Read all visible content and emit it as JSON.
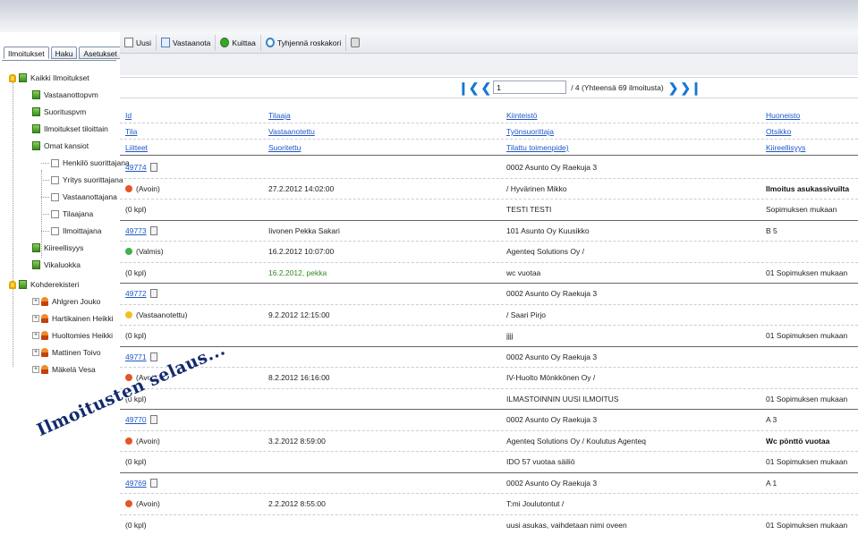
{
  "tabs": [
    "Ilmoitukset",
    "Haku",
    "Asetukset"
  ],
  "tree": {
    "root1": "Kaikki Ilmoitukset",
    "root1_children": [
      "Vastaanottopvm",
      "Suorituspvm",
      "Ilmoitukset tiloittain",
      "Omat kansiot"
    ],
    "omat_kansiot_children": [
      "Henkilö suorittajana",
      "Yritys suorittajana",
      "Vastaanottajana",
      "Tilaajana",
      "Ilmoittajana"
    ],
    "root1_more": [
      "Kiireellisyys",
      "Vikaluokka"
    ],
    "root2": "Kohderekisteri",
    "root2_children": [
      "Ahlgren Jouko",
      "Hartikainen Heikki",
      "Huoltomies Heikki",
      "Mattinen Toivo",
      "Mäkelä Vesa"
    ]
  },
  "toolbar": {
    "new": "Uusi",
    "receive": "Vastaanota",
    "acknowledge": "Kuittaa",
    "empty_trash": "Tyhjennä roskakori"
  },
  "pager": {
    "page": "1",
    "total": "/ 4 (Yhteensä 69 ilmoitusta)"
  },
  "headers": {
    "c1": [
      "Id",
      "Tila",
      "Liitteet"
    ],
    "c2": [
      "Tilaaja",
      "Vastaanotettu",
      "Suoritettu"
    ],
    "c3": [
      "Kiinteistö",
      "Työnsuorittaja",
      "Tilattu toimenpide)"
    ],
    "c4": [
      "Huoneisto",
      "Otsikko",
      "Kiireellisyys"
    ]
  },
  "records": [
    {
      "id": "49774",
      "status": "(Avoin)",
      "status_color": "#e8542a",
      "attachments": "(0 kpl)",
      "customer": "",
      "received": "27.2.2012 14:02:00",
      "done": "",
      "property": "0002 Asunto Oy Raekuja 3",
      "worker": "/ Hyvärinen Mikko",
      "action": "TESTI TESTI",
      "apartment": "",
      "subject": "Ilmoitus asukassivuilta",
      "urgency": "Sopimuksen mukaan"
    },
    {
      "id": "49773",
      "status": "(Valmis)",
      "status_color": "#3fb24a",
      "attachments": "(0 kpl)",
      "customer": "Iivonen Pekka Sakari",
      "received": "16.2.2012 10:07:00",
      "done": "16.2.2012, pekka",
      "property": "101 Asunto Oy Kuusikko",
      "worker": "Agenteq Solutions Oy /",
      "action": "wc vuotaa",
      "apartment": "B 5",
      "subject": "",
      "urgency": "01 Sopimuksen mukaan"
    },
    {
      "id": "49772",
      "status": "(Vastaanotettu)",
      "status_color": "#f0c020",
      "attachments": "(0 kpl)",
      "customer": "",
      "received": "9.2.2012 12:15:00",
      "done": "",
      "property": "0002 Asunto Oy Raekuja 3",
      "worker": "/ Saari Pirjo",
      "action": "jjjj",
      "apartment": "",
      "subject": "",
      "urgency": "01 Sopimuksen mukaan"
    },
    {
      "id": "49771",
      "status": "(Avoin)",
      "status_color": "#e8542a",
      "attachments": "(0 kpl)",
      "customer": "",
      "received": "8.2.2012 16:16:00",
      "done": "",
      "property": "0002 Asunto Oy Raekuja 3",
      "worker": "IV-Huolto Mönkkönen Oy /",
      "action": "ILMASTOINNIN UUSI ILMOITUS",
      "apartment": "",
      "subject": "",
      "urgency": "01 Sopimuksen mukaan"
    },
    {
      "id": "49770",
      "status": "(Avoin)",
      "status_color": "#e8542a",
      "attachments": "(0 kpl)",
      "customer": "",
      "received": "3.2.2012 8:59:00",
      "done": "",
      "property": "0002 Asunto Oy Raekuja 3",
      "worker": "Agenteq Solutions Oy / Koulutus Agenteq",
      "action": "IDO 57 vuotaa säiliö",
      "apartment": "A 3",
      "subject": "Wc pönttö vuotaa",
      "urgency": "01 Sopimuksen mukaan"
    },
    {
      "id": "49769",
      "status": "(Avoin)",
      "status_color": "#e8542a",
      "attachments": "(0 kpl)",
      "customer": "",
      "received": "2.2.2012 8:55:00",
      "done": "",
      "property": "0002 Asunto Oy Raekuja 3",
      "worker": "T:mi Joulutontut /",
      "action": "uusi asukas, vaihdetaan nimi oveen",
      "apartment": "A 1",
      "subject": "",
      "urgency": "01 Sopimuksen mukaan"
    }
  ],
  "overlay_text": "Ilmoitusten selaus..."
}
